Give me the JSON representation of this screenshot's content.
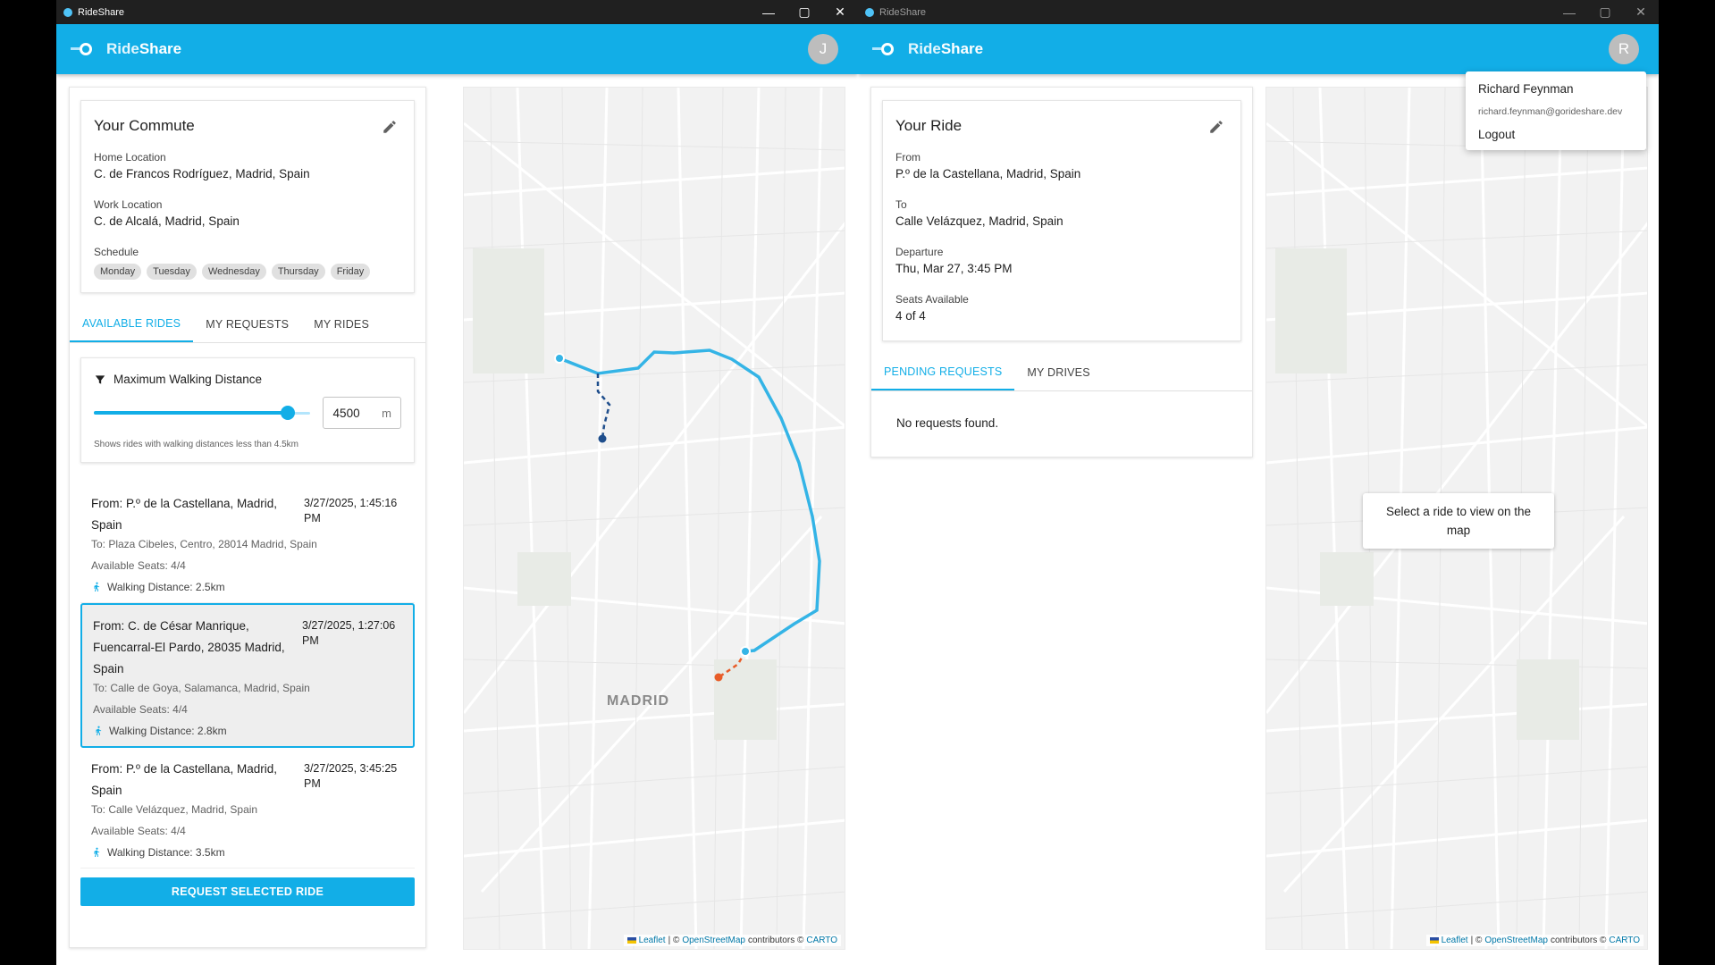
{
  "left_window": {
    "title": "RideShare",
    "brand": {
      "part1": "Ride",
      "part2": "Share"
    },
    "avatar_initial": "J",
    "commute": {
      "title": "Your Commute",
      "home_label": "Home Location",
      "home_value": "C. de Francos Rodríguez, Madrid, Spain",
      "work_label": "Work Location",
      "work_value": "C. de Alcalá, Madrid, Spain",
      "schedule_label": "Schedule",
      "days": [
        "Monday",
        "Tuesday",
        "Wednesday",
        "Thursday",
        "Friday"
      ]
    },
    "tabs": [
      "AVAILABLE RIDES",
      "MY REQUESTS",
      "MY RIDES"
    ],
    "filter": {
      "title": "Maximum Walking Distance",
      "value": "4500",
      "unit": "m",
      "max": 5000,
      "helper": "Shows rides with walking distances less than 4.5km"
    },
    "rides": [
      {
        "from": "From: P.º de la Castellana, Madrid, Spain",
        "time": "3/27/2025, 1:45:16 PM",
        "to": "To: Plaza Cibeles, Centro, 28014 Madrid, Spain",
        "seats": "Available Seats: 4/4",
        "walk": "Walking Distance: 2.5km"
      },
      {
        "from": "From: C. de César Manrique, Fuencarral-El Pardo, 28035 Madrid, Spain",
        "time": "3/27/2025, 1:27:06 PM",
        "to": "To: Calle de Goya, Salamanca, Madrid, Spain",
        "seats": "Available Seats: 4/4",
        "walk": "Walking Distance: 2.8km"
      },
      {
        "from": "From: P.º de la Castellana, Madrid, Spain",
        "time": "3/27/2025, 3:45:25 PM",
        "to": "To: Calle Velázquez, Madrid, Spain",
        "seats": "Available Seats: 4/4",
        "walk": "Walking Distance: 3.5km"
      }
    ],
    "request_button": "REQUEST SELECTED RIDE",
    "map_city": "MADRID",
    "attribution": {
      "leaflet": "Leaflet",
      "sep": "| ©",
      "osm": "OpenStreetMap",
      "contrib": "contributors ©",
      "carto": "CARTO"
    }
  },
  "right_window": {
    "title": "RideShare",
    "brand": {
      "part1": "Ride",
      "part2": "Share"
    },
    "avatar_initial": "R",
    "ride": {
      "title": "Your Ride",
      "from_label": "From",
      "from_value": "P.º de la Castellana, Madrid, Spain",
      "to_label": "To",
      "to_value": "Calle Velázquez, Madrid, Spain",
      "departure_label": "Departure",
      "departure_value": "Thu, Mar 27, 3:45 PM",
      "seats_label": "Seats Available",
      "seats_value": "4 of 4"
    },
    "tabs": [
      "PENDING REQUESTS",
      "MY DRIVES"
    ],
    "no_requests": "No requests found.",
    "map_message": "Select a ride to view on the map",
    "user_menu": {
      "name": "Richard Feynman",
      "email": "richard.feynman@gorideshare.dev",
      "logout": "Logout"
    },
    "attribution": {
      "leaflet": "Leaflet",
      "sep": "| ©",
      "osm": "OpenStreetMap",
      "contrib": "contributors ©",
      "carto": "CARTO"
    }
  }
}
